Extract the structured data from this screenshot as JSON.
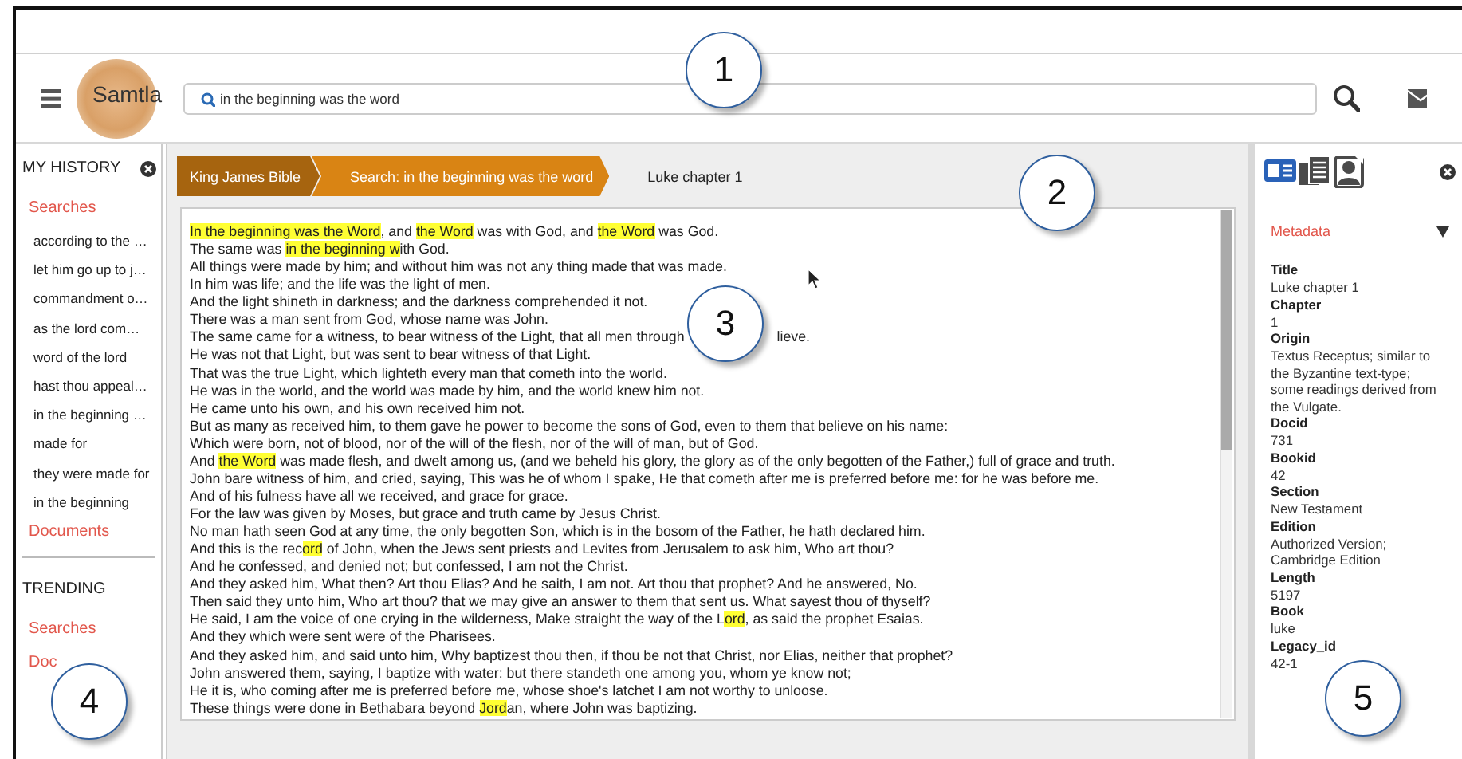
{
  "logo": "Samtla",
  "search": {
    "value": "in the beginning was the word"
  },
  "history": {
    "title": "MY HISTORY",
    "searches_label": "Searches",
    "searches": [
      "according to the …",
      "let him go up to j…",
      "commandment o…",
      "as the lord com…",
      "word of the lord",
      "hast thou appeal…",
      "in the beginning …",
      "made for",
      "they were made for",
      "in the beginning"
    ],
    "documents_label": "Documents"
  },
  "trending": {
    "title": "TRENDING",
    "searches_label": "Searches",
    "documents_label": "Doc"
  },
  "breadcrumb": [
    {
      "label": "King James Bible",
      "kind": "root"
    },
    {
      "label": "Search: in the beginning was the word",
      "kind": "step"
    },
    {
      "label": "Luke chapter 1",
      "kind": "current"
    }
  ],
  "verses": [
    [
      {
        "text": "In the beginning was the Word",
        "highlight": true
      },
      {
        "text": ", and ",
        "highlight": false
      },
      {
        "text": "the Word",
        "highlight": true
      },
      {
        "text": " was with God, and ",
        "highlight": false
      },
      {
        "text": "the Word",
        "highlight": true
      },
      {
        "text": " was God.",
        "highlight": false
      }
    ],
    [
      {
        "text": "The same was ",
        "highlight": false
      },
      {
        "text": "in the beginning w",
        "highlight": true
      },
      {
        "text": "ith God.",
        "highlight": false
      }
    ],
    [
      {
        "text": "All things were made by him; and without him was not any thing made that was made.",
        "highlight": false
      }
    ],
    [
      {
        "text": "In him was life; and the life was the light of men.",
        "highlight": false
      }
    ],
    [
      {
        "text": "And the light shineth in darkness; and the darkness comprehended it not.",
        "highlight": false
      }
    ],
    [
      {
        "text": "There was a man sent from God, whose name was John.",
        "highlight": false
      }
    ],
    [
      {
        "text": "The same came for a witness, to bear witness of the Light, that all men through",
        "highlight": false
      },
      {
        "text": "lieve.",
        "highlight": false,
        "after_gap": true
      }
    ],
    [
      {
        "text": "He was not that Light, but was sent to bear witness of that Light.",
        "highlight": false
      }
    ],
    [
      {
        "text": "That was the true Light, which lighteth every man that cometh into the world.",
        "highlight": false
      }
    ],
    [
      {
        "text": "He was in the world, and the world was made by him, and the world knew him not.",
        "highlight": false
      }
    ],
    [
      {
        "text": "He came unto his own, and his own received him not.",
        "highlight": false
      }
    ],
    [
      {
        "text": "But as many as received him, to them gave he power to become the sons of God, even to them that believe on his name:",
        "highlight": false
      }
    ],
    [
      {
        "text": "Which were born, not of blood, nor of the will of the flesh, nor of the will of man, but of God.",
        "highlight": false
      }
    ],
    [
      {
        "text": "And ",
        "highlight": false
      },
      {
        "text": "the Word",
        "highlight": true
      },
      {
        "text": " was made flesh, and dwelt among us, (and we beheld his glory, the glory as of the only begotten of the Father,) full of grace and truth.",
        "highlight": false
      }
    ],
    [
      {
        "text": "John bare witness of him, and cried, saying, This was he of whom I spake, He that cometh after me is preferred before me: for he was before me.",
        "highlight": false
      }
    ],
    [
      {
        "text": "And of his fulness have all we received, and grace for grace.",
        "highlight": false
      }
    ],
    [
      {
        "text": "For the law was given by Moses, but grace and truth came by Jesus Christ.",
        "highlight": false
      }
    ],
    [
      {
        "text": "No man hath seen God at any time, the only begotten Son, which is in the bosom of the Father, he hath declared him.",
        "highlight": false
      }
    ],
    [
      {
        "text": "And this is the rec",
        "highlight": false
      },
      {
        "text": "ord",
        "highlight": true
      },
      {
        "text": " of John, when the Jews sent priests and Levites from Jerusalem to ask him, Who art thou?",
        "highlight": false
      }
    ],
    [
      {
        "text": "And he confessed, and denied not; but confessed, I am not the Christ.",
        "highlight": false
      }
    ],
    [
      {
        "text": "And they asked him, What then? Art thou Elias? And he saith, I am not. Art thou that prophet? And he answered, No.",
        "highlight": false
      }
    ],
    [
      {
        "text": "Then said they unto him, Who art thou? that we may give an answer to them that sent us. What sayest thou of thyself?",
        "highlight": false
      }
    ],
    [
      {
        "text": "He said, I am the voice of one crying in the wilderness, Make straight the way of the L",
        "highlight": false
      },
      {
        "text": "ord",
        "highlight": true
      },
      {
        "text": ", as said the prophet Esaias.",
        "highlight": false
      }
    ],
    [
      {
        "text": "And they which were sent were of the Pharisees.",
        "highlight": false
      }
    ],
    [
      {
        "text": "And they asked him, and said unto him, Why baptizest thou then, if thou be not that Christ, nor Elias, neither that prophet?",
        "highlight": false
      }
    ],
    [
      {
        "text": "John answered them, saying, I baptize with water: but there standeth one among you, whom ye know not;",
        "highlight": false
      }
    ],
    [
      {
        "text": "He it is, who coming after me is preferred before me, whose shoe's latchet I am not worthy to unloose.",
        "highlight": false
      }
    ],
    [
      {
        "text": "These things were done in Bethabara beyond ",
        "highlight": false
      },
      {
        "text": "Jord",
        "highlight": true
      },
      {
        "text": "an, where John was baptizing.",
        "highlight": false
      }
    ]
  ],
  "panel_tabs": [
    {
      "kind": "card",
      "selected": true
    },
    {
      "kind": "pages",
      "selected": false
    },
    {
      "kind": "person",
      "selected": false
    }
  ],
  "metadata": {
    "title": "Metadata",
    "fields": [
      {
        "label": "Title",
        "value": "Luke chapter 1"
      },
      {
        "label": "Chapter",
        "value": "1"
      },
      {
        "label": "Origin",
        "value": "Textus Receptus; similar to the Byzantine text-type; some readings derived from the Vulgate."
      },
      {
        "label": "Docid",
        "value": "731"
      },
      {
        "label": "Bookid",
        "value": "42"
      },
      {
        "label": "Section",
        "value": "New Testament"
      },
      {
        "label": "Edition",
        "value": "Authorized Version; Cambridge Edition"
      },
      {
        "label": "Length",
        "value": "5197"
      },
      {
        "label": "Book",
        "value": "luke"
      },
      {
        "label": "Legacy_id",
        "value": "42-1"
      }
    ]
  },
  "callouts": [
    "1",
    "2",
    "3",
    "4",
    "5"
  ]
}
